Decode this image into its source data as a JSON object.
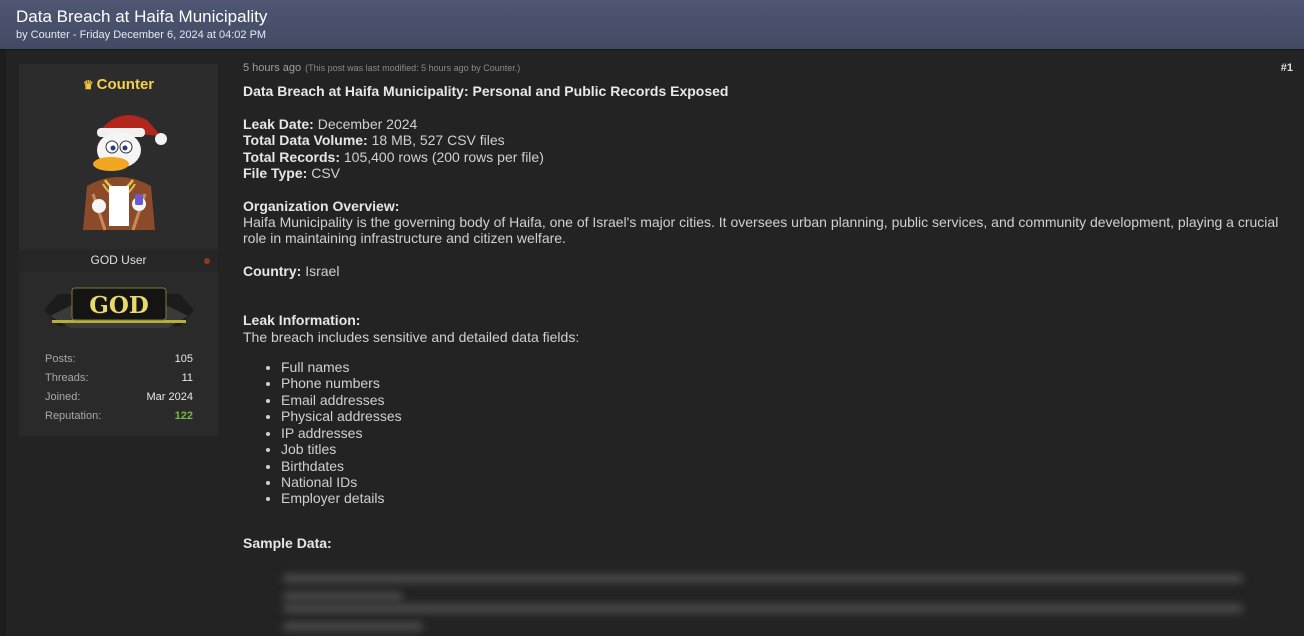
{
  "thread": {
    "title": "Data Breach at Haifa Municipality",
    "byline": "by Counter - Friday December 6, 2024 at 04:02 PM"
  },
  "author": {
    "name": "Counter",
    "crown_icon": "crown-icon",
    "usertitle": "GOD User",
    "rank_badge_text": "GOD",
    "stats": [
      {
        "label": "Posts:",
        "value": "105"
      },
      {
        "label": "Threads:",
        "value": "11"
      },
      {
        "label": "Joined:",
        "value": "Mar 2024"
      },
      {
        "label": "Reputation:",
        "value": "122"
      }
    ],
    "colors": {
      "name": "#f3d24a",
      "reputation": "#79b648"
    }
  },
  "post": {
    "time": "5 hours ago",
    "modified": "(This post was last modified: 5 hours ago by Counter.)",
    "number": "#1",
    "heading": "Data Breach at Haifa Municipality: Personal and Public Records Exposed",
    "leak_date_label": "Leak Date:",
    "leak_date": "December 2024",
    "volume_label": "Total Data Volume:",
    "volume": "18 MB, 527 CSV files",
    "records_label": "Total Records:",
    "records": "105,400 rows (200 rows per file)",
    "filetype_label": "File Type:",
    "filetype": "CSV",
    "org_label": "Organization Overview:",
    "org_text": "Haifa Municipality is the governing body of Haifa, one of Israel's major cities. It oversees urban planning, public services, and community development, playing a crucial role in maintaining infrastructure and citizen welfare.",
    "country_label": "Country:",
    "country": "Israel",
    "leakinfo_label": "Leak Information:",
    "leakinfo_text": "The breach includes sensitive and detailed data fields:",
    "fields": [
      "Full names",
      "Phone numbers",
      "Email addresses",
      "Physical addresses",
      "IP addresses",
      "Job titles",
      "Birthdates",
      "National IDs",
      "Employer details"
    ],
    "sample_label": "Sample Data:"
  }
}
